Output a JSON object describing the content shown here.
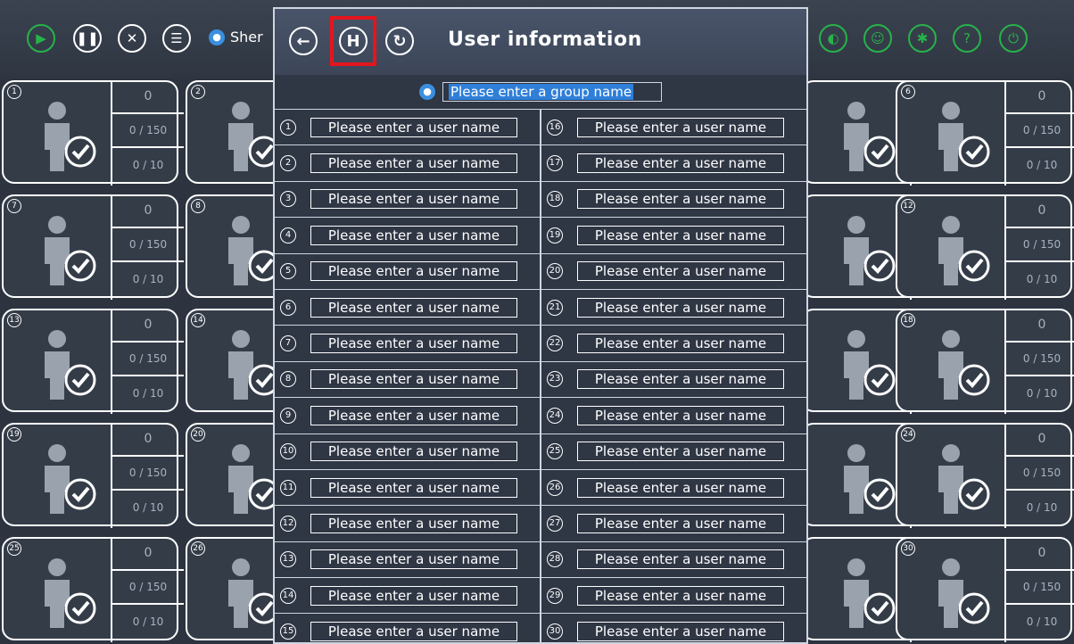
{
  "toolbar": {
    "group_label": "Sher",
    "colors": {
      "green": "#27b34a",
      "accent": "#2f7fd9",
      "highlight": "#e5151d"
    }
  },
  "cards": [
    {
      "num": "1",
      "v1": "0",
      "v2": "0 / 150",
      "v3": "0 / 10"
    },
    {
      "num": "2",
      "v1": "",
      "v2": "",
      "v3": ""
    },
    {
      "num": "",
      "v1": "0",
      "v2": "0 / 150",
      "v3": "0 / 10"
    },
    {
      "num": "6",
      "v1": "0",
      "v2": "0 / 150",
      "v3": "0 / 10"
    },
    {
      "num": "7",
      "v1": "0",
      "v2": "0 / 150",
      "v3": "0 / 10"
    },
    {
      "num": "8",
      "v1": "",
      "v2": "",
      "v3": ""
    },
    {
      "num": "",
      "v1": "0",
      "v2": "0 / 150",
      "v3": "0 / 10"
    },
    {
      "num": "12",
      "v1": "0",
      "v2": "0 / 150",
      "v3": "0 / 10"
    },
    {
      "num": "13",
      "v1": "0",
      "v2": "0 / 150",
      "v3": "0 / 10"
    },
    {
      "num": "14",
      "v1": "",
      "v2": "",
      "v3": ""
    },
    {
      "num": "",
      "v1": "0",
      "v2": "0 / 150",
      "v3": "0 / 10"
    },
    {
      "num": "18",
      "v1": "0",
      "v2": "0 / 150",
      "v3": "0 / 10"
    },
    {
      "num": "19",
      "v1": "0",
      "v2": "0 / 150",
      "v3": "0 / 10"
    },
    {
      "num": "20",
      "v1": "",
      "v2": "",
      "v3": ""
    },
    {
      "num": "",
      "v1": "0",
      "v2": "0 / 150",
      "v3": "0 / 10"
    },
    {
      "num": "24",
      "v1": "0",
      "v2": "0 / 150",
      "v3": "0 / 10"
    },
    {
      "num": "25",
      "v1": "0",
      "v2": "0 / 150",
      "v3": "0 / 10"
    },
    {
      "num": "26",
      "v1": "",
      "v2": "",
      "v3": ""
    },
    {
      "num": "",
      "v1": "0",
      "v2": "0 / 150",
      "v3": "0 / 10"
    },
    {
      "num": "30",
      "v1": "0",
      "v2": "0 / 150",
      "v3": "0 / 10"
    }
  ],
  "dialog": {
    "title": "User information",
    "group_placeholder": "Please enter a group name",
    "user_placeholder": "Please enter a user name",
    "left_nums": [
      "1",
      "2",
      "3",
      "4",
      "5",
      "6",
      "7",
      "8",
      "9",
      "10",
      "11",
      "12",
      "13",
      "14",
      "15"
    ],
    "right_nums": [
      "16",
      "17",
      "18",
      "19",
      "20",
      "21",
      "22",
      "23",
      "24",
      "25",
      "26",
      "27",
      "28",
      "29",
      "30"
    ]
  }
}
